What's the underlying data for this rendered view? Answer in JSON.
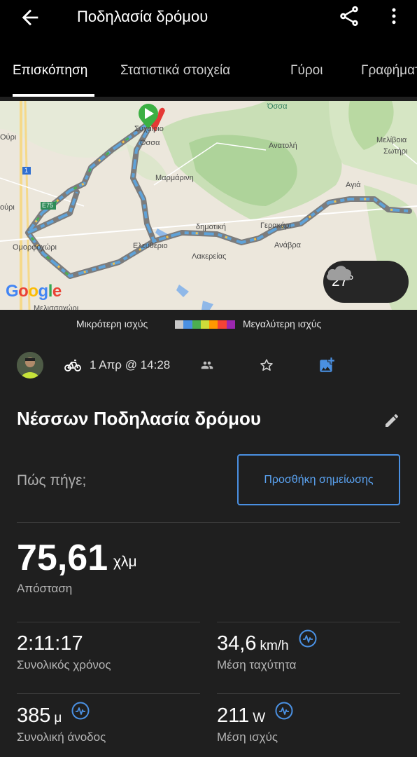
{
  "header": {
    "title": "Ποδηλασία δρόμου",
    "tabs": [
      {
        "label": "Επισκόπηση",
        "active": true
      },
      {
        "label": "Στατιστικά στοιχεία"
      },
      {
        "label": "Γύροι"
      },
      {
        "label": "Γραφήματα"
      }
    ]
  },
  "map": {
    "labels": [
      "Όσσα",
      "Συχαίριο",
      "Όσσα",
      "Ανατολή",
      "Μελίβοια",
      "Σωτήρι",
      "Μαρμάρινη",
      "Αγιά",
      "1",
      "E75",
      "Ούρι",
      "ούρι",
      "δημοτική",
      "Γερακάρι",
      "Ομορφοχώρι",
      "Ελευθέριο",
      "Λακερείας",
      "Ανάβρα",
      "Μελισσοχώρι"
    ],
    "google_logo": "Google",
    "weather_temp": "27°",
    "weather_icon": "cloud-icon"
  },
  "legend": {
    "low_label": "Μικρότερη ισχύς",
    "high_label": "Μεγαλύτερη ισχύς",
    "colors": [
      "#c8c8c8",
      "#4a90e2",
      "#4caf50",
      "#cddc39",
      "#ff9800",
      "#f44336",
      "#9c27b0"
    ]
  },
  "activity": {
    "date": "1 Απρ @ 14:28",
    "name": "Νέσσων Ποδηλασία δρόμου",
    "how_prompt": "Πώς πήγε;",
    "add_note_label": "Προσθήκη σημείωσης"
  },
  "stats": {
    "distance": {
      "value": "75,61",
      "unit": "χλμ",
      "label": "Απόσταση"
    },
    "total_time": {
      "value": "2:11:17",
      "label": "Συνολικός χρόνος"
    },
    "avg_speed": {
      "value": "34,6",
      "unit": "km/h",
      "label": "Μέση ταχύτητα"
    },
    "total_ascent": {
      "value": "385",
      "unit": "μ",
      "label": "Συνολική άνοδος"
    },
    "avg_power": {
      "value": "211",
      "unit": "W",
      "label": "Μέση ισχύς"
    }
  },
  "colors": {
    "accent": "#4a90e2",
    "background": "#1f1f1f",
    "topbar": "#000000"
  }
}
